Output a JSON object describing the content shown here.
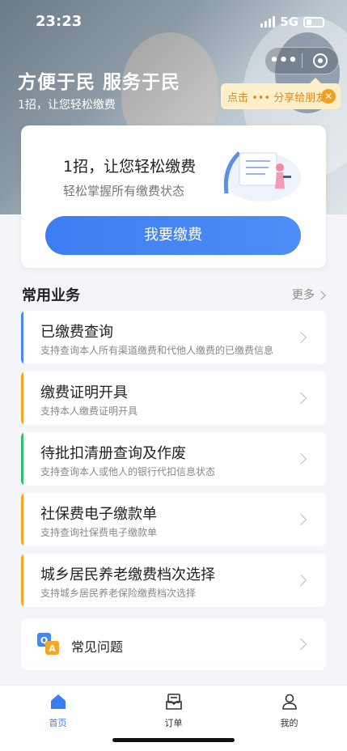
{
  "status_bar": {
    "time": "23:23",
    "network": "5G"
  },
  "hero": {
    "title": "方便于民 服务于民",
    "subtitle": "1招，让您轻松缴费",
    "share_tip": "点击 ••• 分享给朋友"
  },
  "pay_card": {
    "heading": "1招，让您轻松缴费",
    "subheading": "轻松掌握所有缴费状态",
    "button": "我要缴费"
  },
  "section": {
    "title": "常用业务",
    "more": "更多"
  },
  "services": [
    {
      "title": "已缴费查询",
      "desc": "支持查询本人所有渠道缴费和代他人缴费的已缴费信息",
      "color": "#4a86f0"
    },
    {
      "title": "缴费证明开具",
      "desc": "支持本人缴费证明开具",
      "color": "#f5a623"
    },
    {
      "title": "待批扣清册查询及作废",
      "desc": "支持查询本人或他人的银行代扣信息状态",
      "color": "#2ec06a"
    },
    {
      "title": "社保费电子缴款单",
      "desc": "支持查询社保费电子缴款单",
      "color": "#f5a623"
    },
    {
      "title": "城乡居民养老缴费档次选择",
      "desc": "支持城乡居民养老保险缴费档次选择",
      "color": "#f5a623"
    }
  ],
  "faq": {
    "label": "常见问题"
  },
  "tabs": [
    {
      "label": "首页",
      "icon": "home-icon"
    },
    {
      "label": "订单",
      "icon": "order-icon"
    },
    {
      "label": "我的",
      "icon": "profile-icon"
    }
  ],
  "colors": {
    "primary": "#3d7df2",
    "tip_bg": "#fcefc9",
    "tip_text": "#e08a1a"
  }
}
